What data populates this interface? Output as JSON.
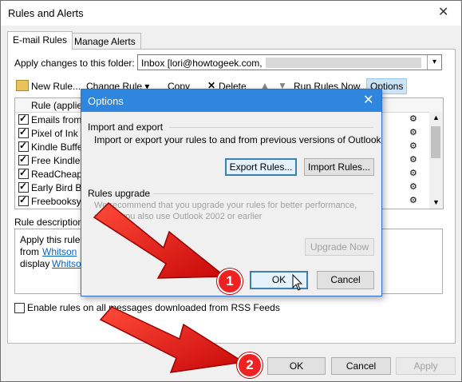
{
  "window": {
    "title": "Rules and Alerts",
    "close_glyph": "✕"
  },
  "tabs": [
    {
      "label": "E-mail Rules"
    },
    {
      "label": "Manage Alerts"
    }
  ],
  "folder": {
    "label": "Apply changes to this folder:",
    "value": "Inbox [lori@howtogeek.com,"
  },
  "toolbar": {
    "new_rule": "New Rule...",
    "change_rule": "Change Rule ▾",
    "copy": "Copy",
    "delete": "Delete",
    "run_rules_now": "Run Rules Now...",
    "options": "Options"
  },
  "rules": {
    "header": "Rule (applied",
    "items": [
      {
        "name": "Emails from V"
      },
      {
        "name": "Pixel of Ink"
      },
      {
        "name": "Kindle Buffet"
      },
      {
        "name": "Free Kindle B"
      },
      {
        "name": "ReadCheaply"
      },
      {
        "name": "Early Bird Bo"
      },
      {
        "name": "Freebooksy"
      }
    ]
  },
  "description": {
    "label": "Rule description",
    "line1": "Apply this rule",
    "line2_prefix": "from",
    "line2_link": "Whitson",
    "line3_prefix": "display",
    "line3_link": "Whitso"
  },
  "rss": {
    "label": "Enable rules on all messages downloaded from RSS Feeds"
  },
  "footer": {
    "ok": "OK",
    "cancel": "Cancel",
    "apply": "Apply"
  },
  "options_dialog": {
    "title": "Options",
    "close_glyph": "✕",
    "import_export_heading": "Import and export",
    "import_export_desc": "Import or export your rules to and from previous versions of Outlook",
    "export_rules": "Export Rules...",
    "import_rules": "Import Rules...",
    "upgrade_heading": "Rules upgrade",
    "upgrade_desc_1": "We recommend that you upgrade your rules for better performance,",
    "upgrade_desc_2": "u         you also use Outlook 2002 or earlier",
    "upgrade_now": "Upgrade Now",
    "ok": "OK",
    "cancel": "Cancel"
  },
  "callouts": [
    {
      "number": "1"
    },
    {
      "number": "2"
    }
  ],
  "colors": {
    "accent": "#2e86de",
    "arrow_red": "#e81010",
    "link": "#0563c1"
  }
}
